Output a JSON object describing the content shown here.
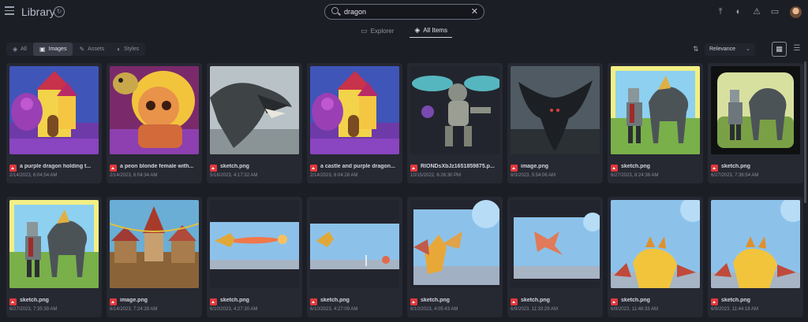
{
  "header": {
    "title": "Library",
    "search_value": "dragon"
  },
  "view_tabs": [
    {
      "label": "Explorer",
      "icon": "folder-icon",
      "active": false
    },
    {
      "label": "All Items",
      "icon": "layers-icon",
      "active": true
    }
  ],
  "filters": [
    {
      "label": "All",
      "icon": "layers-icon",
      "active": false
    },
    {
      "label": "Images",
      "icon": "image-icon",
      "active": true
    },
    {
      "label": "Assets",
      "icon": "pencil-icon",
      "active": false
    },
    {
      "label": "Styles",
      "icon": "palette-icon",
      "active": false
    }
  ],
  "sort": {
    "selected": "Relevance"
  },
  "items": [
    {
      "title": "a purple dragon holding t...",
      "date": "2/14/2023, 6:04:54 AM",
      "art": "castle"
    },
    {
      "title": "a peon blonde female with...",
      "date": "2/14/2023, 6:04:34 AM",
      "art": "peon"
    },
    {
      "title": "sketch.png",
      "date": "5/16/2023, 4:17:32 AM",
      "art": "greydragon"
    },
    {
      "title": "a castle and purple dragon...",
      "date": "2/14/2023, 6:04:28 AM",
      "art": "castle"
    },
    {
      "title": "RIONDsXbJz1651859875.p...",
      "date": "10/15/2022, 6:26:30 PM",
      "art": "bug"
    },
    {
      "title": "image.png",
      "date": "8/3/2023, 5:54:06 AM",
      "art": "darkdragon"
    },
    {
      "title": "sketch.png",
      "date": "6/27/2023, 8:24:38 AM",
      "art": "knight"
    },
    {
      "title": "sketch.png",
      "date": "6/27/2023, 7:36:54 AM",
      "art": "knightdark"
    },
    {
      "title": "sketch.png",
      "date": "6/27/2023, 7:35:39 AM",
      "art": "knight"
    },
    {
      "title": "image.png",
      "date": "6/14/2023, 7:24:28 AM",
      "art": "village"
    },
    {
      "title": "sketch.png",
      "date": "6/10/2023, 4:27:30 AM",
      "art": "skyfire"
    },
    {
      "title": "sketch.png",
      "date": "6/10/2023, 4:27:09 AM",
      "art": "skysmall"
    },
    {
      "title": "sketch.png",
      "date": "6/10/2023, 4:05:43 AM",
      "art": "skydragon"
    },
    {
      "title": "sketch.png",
      "date": "6/9/2023, 11:33:29 AM",
      "art": "skyflying"
    },
    {
      "title": "sketch.png",
      "date": "6/9/2023, 11:48:33 AM",
      "art": "skyyellow"
    },
    {
      "title": "sketch.png",
      "date": "6/9/2023, 11:44:18 AM",
      "art": "skyyellow"
    }
  ]
}
